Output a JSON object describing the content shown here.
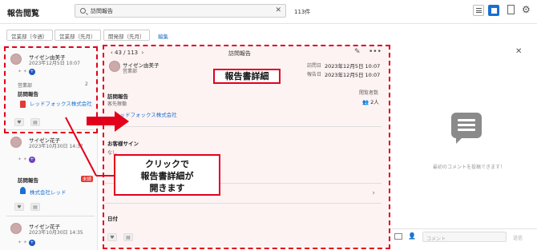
{
  "app": {
    "title": "報告閲覧"
  },
  "search": {
    "value": "訪問報告",
    "clear": "✕"
  },
  "result_count": "113件",
  "filters": [
    "営業部（今週）",
    "営業部（先月）",
    "開発部（先月）"
  ],
  "filters_edit": "編集",
  "list": [
    {
      "name": "サイゼン由美子",
      "date": "2023年12月5日 10:07",
      "dept": "営業部",
      "type": "訪問報告",
      "company": "レッドフォックス株式会社",
      "count": "2",
      "unread": ""
    },
    {
      "name": "サイゼン花子",
      "date": "2023年10月30日 14:37",
      "dept": "",
      "type": "訪問報告",
      "company": "株式会社レッド",
      "count": "",
      "unread": "未読"
    },
    {
      "name": "サイゼン花子",
      "date": "2023年10月30日 14:35",
      "dept": "",
      "type": "",
      "company": "",
      "count": "",
      "unread": ""
    }
  ],
  "detail": {
    "pager": "43 / 113",
    "title": "訪問報告",
    "author": "サイゼン由美子",
    "author_dept": "営業部",
    "visit_date_label": "訪問日",
    "visit_date": "2023年12月5日 10:07",
    "report_date_label": "報告日",
    "report_date": "2023年12月5日 10:07",
    "report_type": "訪問報告",
    "subject": "客先稼働",
    "views_label": "閲覧者数",
    "views": "2人",
    "company": "レッドフォックス株式会社",
    "signature_label": "お客様サイン",
    "signature_value": "なし",
    "date_label": "日付"
  },
  "callouts": {
    "detail": "報告書詳細",
    "click_line1": "クリックで",
    "click_line2": "報告書詳細が",
    "click_line3": "開きます"
  },
  "comments": {
    "empty": "最初のコメントを投稿できます！",
    "placeholder": "コメント",
    "send": "送信"
  },
  "colors": {
    "accent": "#1a6fd1",
    "annotation": "#e3001b",
    "badge": "#e53935"
  }
}
